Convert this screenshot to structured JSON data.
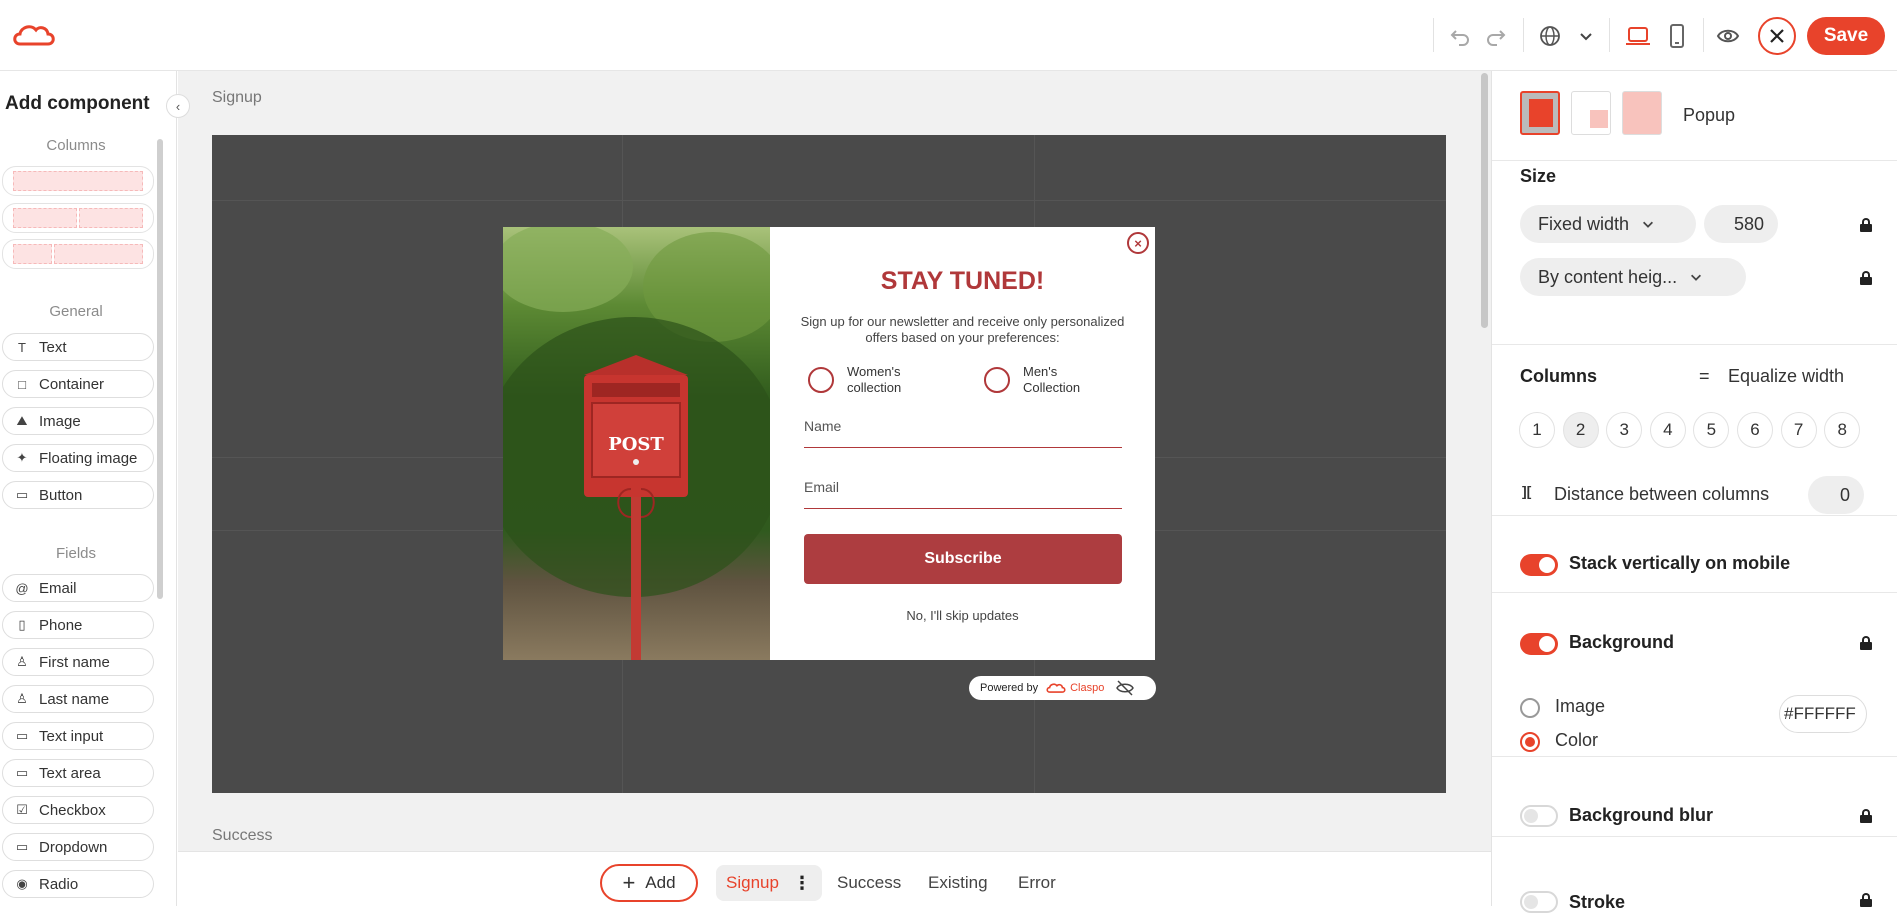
{
  "topbar": {
    "logo": "claspo-logo-icon",
    "save_label": "Save",
    "icons": [
      "undo-icon",
      "redo-icon",
      "globe-icon",
      "chevron-down-icon",
      "desktop-icon",
      "mobile-icon",
      "preview-eye-icon",
      "close-icon"
    ]
  },
  "left_panel": {
    "title": "Add component",
    "sections": {
      "columns": "Columns",
      "general": "General",
      "fields": "Fields"
    },
    "general_items": [
      {
        "label": "Text",
        "icon": "T"
      },
      {
        "label": "Container",
        "icon": "□"
      },
      {
        "label": "Image",
        "icon": "⛰"
      },
      {
        "label": "Floating image",
        "icon": "✦"
      },
      {
        "label": "Button",
        "icon": "▭"
      }
    ],
    "field_items": [
      {
        "label": "Email",
        "icon": "@"
      },
      {
        "label": "Phone",
        "icon": "▯"
      },
      {
        "label": "First name",
        "icon": "♙"
      },
      {
        "label": "Last name",
        "icon": "♙"
      },
      {
        "label": "Text input",
        "icon": "▭"
      },
      {
        "label": "Text area",
        "icon": "▭"
      },
      {
        "label": "Checkbox",
        "icon": "☑"
      },
      {
        "label": "Dropdown",
        "icon": "▭"
      },
      {
        "label": "Radio",
        "icon": "◉"
      }
    ]
  },
  "canvas": {
    "signup_label": "Signup",
    "success_label": "Success",
    "popup": {
      "title": "STAY TUNED!",
      "subtitle": "Sign up for our newsletter and receive only personalized offers based on your preferences:",
      "option1": "Women's collection",
      "option2": "Men's Collection",
      "name_placeholder": "Name",
      "email_placeholder": "Email",
      "subscribe_label": "Subscribe",
      "skip_label": "No, I'll skip updates",
      "mailbox_text": "POST"
    },
    "powered_by": "Powered by",
    "brand": "Claspo"
  },
  "bottom_tabs": {
    "add_label": "Add",
    "tabs": [
      "Signup",
      "Success",
      "Existing",
      "Error"
    ],
    "active": "Signup"
  },
  "right_panel": {
    "layout_label": "Popup",
    "size": {
      "title": "Size",
      "width_mode": "Fixed width",
      "width_value": "580",
      "height_mode": "By content heig..."
    },
    "columns": {
      "title": "Columns",
      "equalize_icon": "=",
      "equalize_label": "Equalize width",
      "options": [
        "1",
        "2",
        "3",
        "4",
        "5",
        "6",
        "7",
        "8"
      ],
      "selected": "2",
      "distance_label": "Distance between columns",
      "distance_value": "0"
    },
    "stack_label": "Stack vertically on mobile",
    "stack_on": true,
    "background": {
      "title": "Background",
      "on": true,
      "image_label": "Image",
      "color_label": "Color",
      "selected": "Color",
      "color_value": "#FFFFFF"
    },
    "blur_label": "Background blur",
    "blur_on": false,
    "stroke_label": "Stroke"
  },
  "colors": {
    "accent": "#e8432b",
    "popup_accent": "#b0383a",
    "stage_bg": "#4a4a4a"
  }
}
